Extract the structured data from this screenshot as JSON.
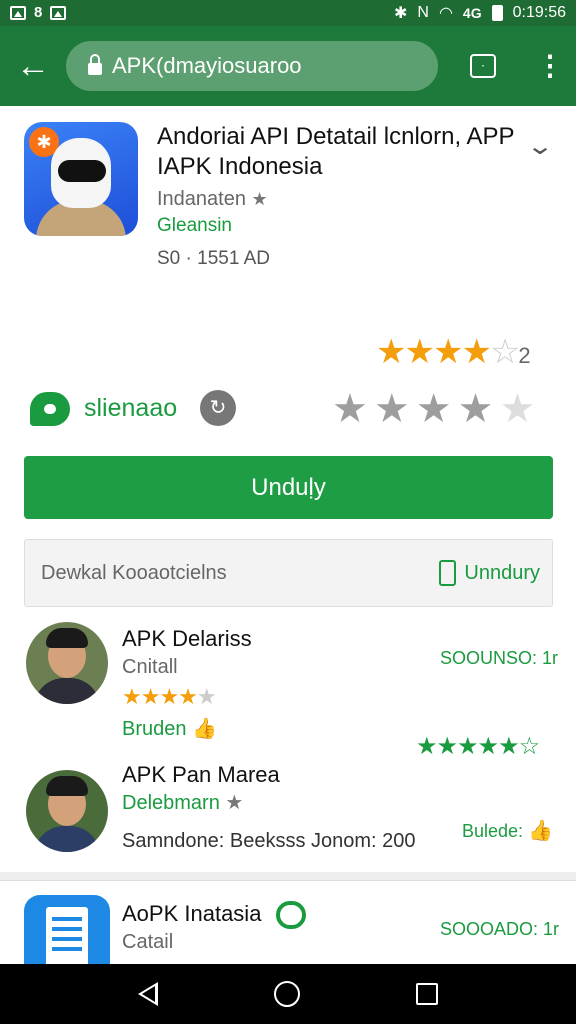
{
  "status_bar": {
    "time": "0:19:56",
    "signal_label": "4G"
  },
  "toolbar": {
    "back_glyph": "←",
    "url": "APK(dmayiosuaroo",
    "tab_glyph": "⋅",
    "menu_glyph": "⋮"
  },
  "app": {
    "title": "Andoriai API Detatail lcnlorn, APP IAPK Indonesia",
    "developer": "Indanaten",
    "category": "Gleansin",
    "size": "S0 · 1551 AD",
    "rating_count": "2",
    "rating_value": 4.5,
    "chat_label": "slienaao",
    "grey_stars_value": 4.5,
    "install_label": "Unduḷy"
  },
  "banner": {
    "text": "Dewkal Kooaotcielns",
    "link_label": "Unndury"
  },
  "reviews": [
    {
      "name": "APK Delariss",
      "subtitle": "Cnitall",
      "stars": 4,
      "green_label": "Bruden",
      "score": "SOOUNSO: 1r",
      "green_stars": 5
    },
    {
      "name": "APK Pan Marea",
      "subtitle": "Delebmarn",
      "body": "Samndone: Beeksss Jonom: 200",
      "score": "Bulede:"
    }
  ],
  "app2": {
    "name": "AoPK Inatasia",
    "subtitle": "Catail",
    "score": "SOOOADO: 1r"
  }
}
